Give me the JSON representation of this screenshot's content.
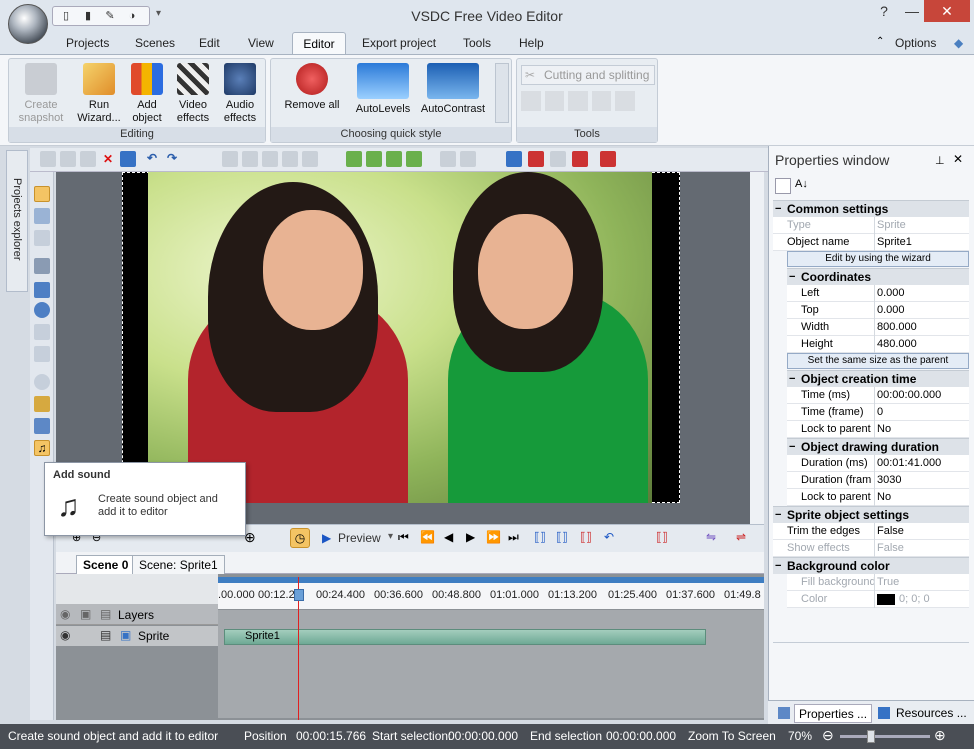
{
  "window": {
    "title": "VSDC Free Video Editor",
    "controls": {
      "help": "?",
      "minimize": "—",
      "maximize": "☐",
      "close": "✕"
    }
  },
  "menu": {
    "items": [
      "Projects",
      "Scenes",
      "Edit",
      "View",
      "Editor",
      "Export project",
      "Tools",
      "Help"
    ],
    "active": "Editor",
    "options": "Options"
  },
  "ribbon": {
    "groups": {
      "editing": "Editing",
      "quick_style": "Choosing quick style",
      "tools": "Tools"
    },
    "buttons": {
      "create_snapshot": [
        "Create",
        "snapshot"
      ],
      "run_wizard": [
        "Run",
        "Wizard..."
      ],
      "add_object": [
        "Add",
        "object"
      ],
      "video_effects": [
        "Video",
        "effects"
      ],
      "audio_effects": [
        "Audio",
        "effects"
      ],
      "remove_all": "Remove all",
      "autolevels": "AutoLevels",
      "autocontrast": "AutoContrast",
      "cutting_splitting": "Cutting and splitting"
    }
  },
  "sidebar": {
    "projects_explorer": "Projects explorer"
  },
  "tooltip": {
    "title": "Add sound",
    "description": "Create sound object and add it to editor",
    "icon": "music-note-icon"
  },
  "player": {
    "preview": "Preview"
  },
  "timeline": {
    "tabs": [
      "Scene 0",
      "Scene: Sprite1"
    ],
    "ticks": [
      ".00.000",
      "00:12.2",
      "00:24.400",
      "00:36.600",
      "00:48.800",
      "01:01.000",
      "01:13.200",
      "01:25.400",
      "01:37.600",
      "01:49.8"
    ],
    "layers_label": "Layers",
    "sprite_label": "Sprite",
    "clip_label": "Sprite1"
  },
  "properties": {
    "title": "Properties window",
    "common_settings": "Common settings",
    "type_label": "Type",
    "type_value": "Sprite",
    "object_name_label": "Object name",
    "object_name_value": "Sprite1",
    "edit_wizard": "Edit by using the wizard",
    "coordinates": "Coordinates",
    "left_label": "Left",
    "left_value": "0.000",
    "top_label": "Top",
    "top_value": "0.000",
    "width_label": "Width",
    "width_value": "800.000",
    "height_label": "Height",
    "height_value": "480.000",
    "same_size": "Set the same size as the parent",
    "creation_time": "Object creation time",
    "time_ms_label": "Time (ms)",
    "time_ms_value": "00:00:00.000",
    "time_frame_label": "Time (frame)",
    "time_frame_value": "0",
    "lock_parent_label": "Lock to parent",
    "lock_parent_value": "No",
    "drawing_duration": "Object drawing duration",
    "duration_ms_label": "Duration (ms)",
    "duration_ms_value": "00:01:41.000",
    "duration_frame_label": "Duration (fram",
    "duration_frame_value": "3030",
    "lock_parent2_label": "Lock to parent",
    "lock_parent2_value": "No",
    "sprite_settings": "Sprite object settings",
    "trim_label": "Trim the edges",
    "trim_value": "False",
    "show_effects_label": "Show effects",
    "show_effects_value": "False",
    "background_color": "Background color",
    "fill_bg_label": "Fill background",
    "fill_bg_value": "True",
    "color_label": "Color",
    "color_value": "0; 0; 0",
    "color_swatch": "#000000",
    "tab_properties": "Properties ...",
    "tab_resources": "Resources ..."
  },
  "status": {
    "message": "Create sound object and add it to editor",
    "position": "Position",
    "position_value": "00:00:15.766",
    "start_selection": "Start selection:",
    "start_value": "00:00:00.000",
    "end_selection": "End selection",
    "end_value": "00:00:00.000",
    "zoom_to_screen": "Zoom To Screen",
    "zoom_value": "70%"
  }
}
